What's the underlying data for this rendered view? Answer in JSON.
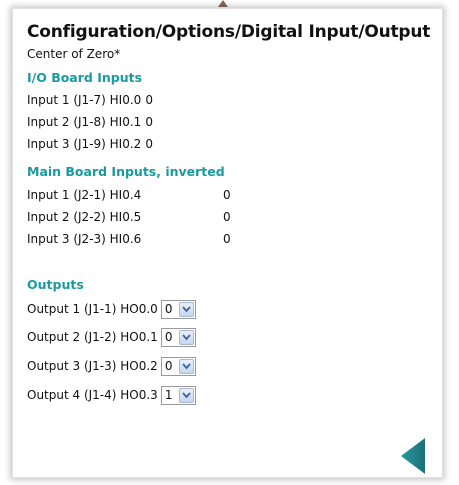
{
  "page": {
    "title": "Configuration/Options/Digital Input/Output",
    "subtitle": "Center of Zero*"
  },
  "io_board": {
    "heading": "I/O Board Inputs",
    "inputs": [
      {
        "label": "Input 1 (J1-7) HI0.0",
        "value": "0"
      },
      {
        "label": "Input 2 (J1-8) HI0.1",
        "value": "0"
      },
      {
        "label": "Input 3 (J1-9) HI0.2",
        "value": "0"
      }
    ]
  },
  "main_board": {
    "heading": "Main Board Inputs, inverted",
    "inputs": [
      {
        "label": "Input 1 (J2-1) HI0.4",
        "value": "0"
      },
      {
        "label": "Input 2 (J2-2) HI0.5",
        "value": "0"
      },
      {
        "label": "Input 3 (J2-3) HI0.6",
        "value": "0"
      }
    ]
  },
  "outputs": {
    "heading": "Outputs",
    "items": [
      {
        "label": "Output 1 (J1-1) HO0.0",
        "selected": "0"
      },
      {
        "label": "Output 2 (J1-2) HO0.1",
        "selected": "0"
      },
      {
        "label": "Output 3 (J1-3) HO0.2",
        "selected": "0"
      },
      {
        "label": "Output 4 (J1-4) HO0.3",
        "selected": "1"
      }
    ]
  },
  "colors": {
    "section_heading": "#1a9aa0",
    "back_button": "#1f7f88"
  },
  "icons": {
    "back": "left-triangle-icon",
    "dropdown": "chevron-down-icon"
  }
}
